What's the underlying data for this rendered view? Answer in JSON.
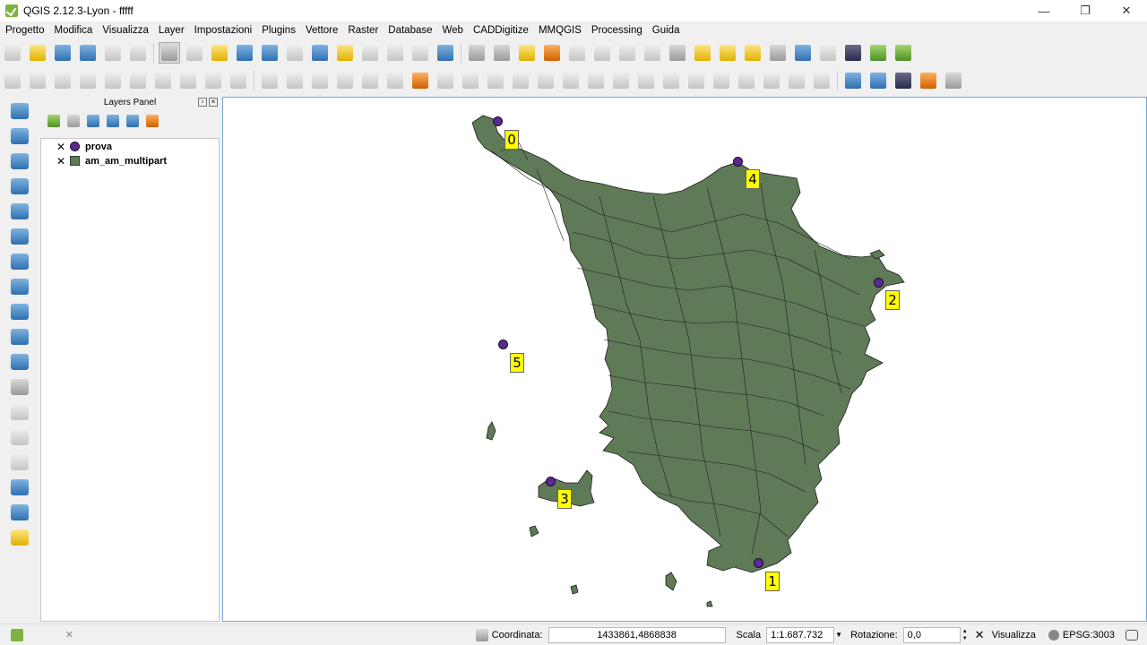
{
  "window": {
    "title": "QGIS 2.12.3-Lyon - fffff",
    "controls": {
      "minimize": "—",
      "maximize": "❐",
      "close": "✕"
    }
  },
  "menu": [
    "Progetto",
    "Modifica",
    "Visualizza",
    "Layer",
    "Impostazioni",
    "Plugins",
    "Vettore",
    "Raster",
    "Database",
    "Web",
    "CADDigitize",
    "MMQGIS",
    "Processing",
    "Guida"
  ],
  "layers_panel": {
    "title": "Layers Panel",
    "layers": [
      {
        "name": "prova",
        "visible": true,
        "symbol": "point",
        "color": "#5b2a91"
      },
      {
        "name": "am_am_multipart",
        "visible": true,
        "symbol": "polygon",
        "color": "#5f7a57"
      }
    ]
  },
  "map": {
    "fill_color": "#5f7a57",
    "stroke_color": "#1e1e1e",
    "point_color": "#5b2a91",
    "label_bg": "#ffff00",
    "labels": [
      "0",
      "4",
      "2",
      "5",
      "3",
      "1"
    ]
  },
  "statusbar": {
    "coord_label": "Coordinata:",
    "coord_value": "1433861,4868838",
    "scale_label": "Scala",
    "scale_value": "1:1.687.732",
    "rotation_label": "Rotazione:",
    "rotation_value": "0,0",
    "render_label": "Visualizza",
    "crs_label": "EPSG:3003"
  }
}
